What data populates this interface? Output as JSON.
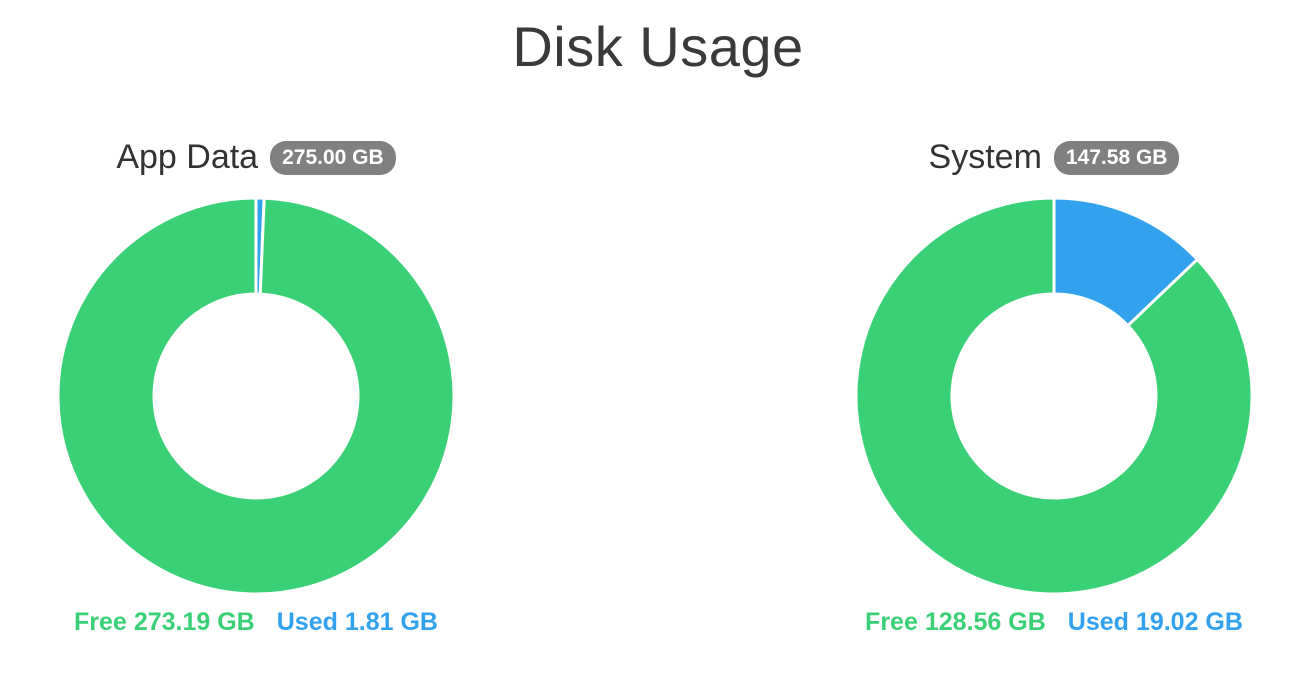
{
  "title": "Disk Usage",
  "colors": {
    "free": "#3ad176",
    "used": "#32a2ef",
    "badge": "#808080"
  },
  "chart_data": [
    {
      "type": "pie",
      "title": "App Data",
      "total_label": "275.00 GB",
      "slices": [
        {
          "label": "Free",
          "value": 273.19,
          "value_label": "273.19 GB"
        },
        {
          "label": "Used",
          "value": 1.81,
          "value_label": "1.81 GB"
        }
      ],
      "donut": true
    },
    {
      "type": "pie",
      "title": "System",
      "total_label": "147.58 GB",
      "slices": [
        {
          "label": "Free",
          "value": 128.56,
          "value_label": "128.56 GB"
        },
        {
          "label": "Used",
          "value": 19.02,
          "value_label": "19.02 GB"
        }
      ],
      "donut": true
    }
  ]
}
